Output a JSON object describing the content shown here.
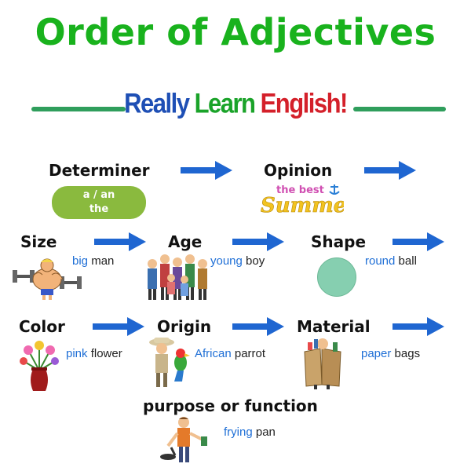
{
  "title": "Order of Adjectives",
  "brand": {
    "really": "Really",
    "learn": "Learn",
    "english": "English!"
  },
  "categories": {
    "determiner": {
      "label": "Determiner",
      "examples": [
        "a / an",
        "the"
      ]
    },
    "opinion": {
      "label": "Opinion",
      "logo_small": "the best",
      "logo_big": "Summer"
    },
    "size": {
      "label": "Size",
      "adj": "big",
      "noun": "man"
    },
    "age": {
      "label": "Age",
      "adj": "young",
      "noun": "boy"
    },
    "shape": {
      "label": "Shape",
      "adj": "round",
      "noun": "ball"
    },
    "color": {
      "label": "Color",
      "adj": "pink",
      "noun": "flower"
    },
    "origin": {
      "label": "Origin",
      "adj": "African",
      "noun": "parrot"
    },
    "material": {
      "label": "Material",
      "adj": "paper",
      "noun": "bags"
    },
    "purpose": {
      "label": "purpose or function",
      "adj": "frying",
      "noun": "pan"
    }
  },
  "colors": {
    "title": "#19b21d",
    "arrow": "#1f66d1",
    "highlight": "#1f6fd6",
    "determiner_box": "#8aba3e",
    "ball": "#86cfb0"
  },
  "icons": [
    "arrow-right-icon",
    "bodybuilder-icon",
    "family-group-icon",
    "round-ball-icon",
    "flower-vase-icon",
    "explorer-parrot-icon",
    "paper-bags-icon",
    "frying-pan-cook-icon"
  ]
}
